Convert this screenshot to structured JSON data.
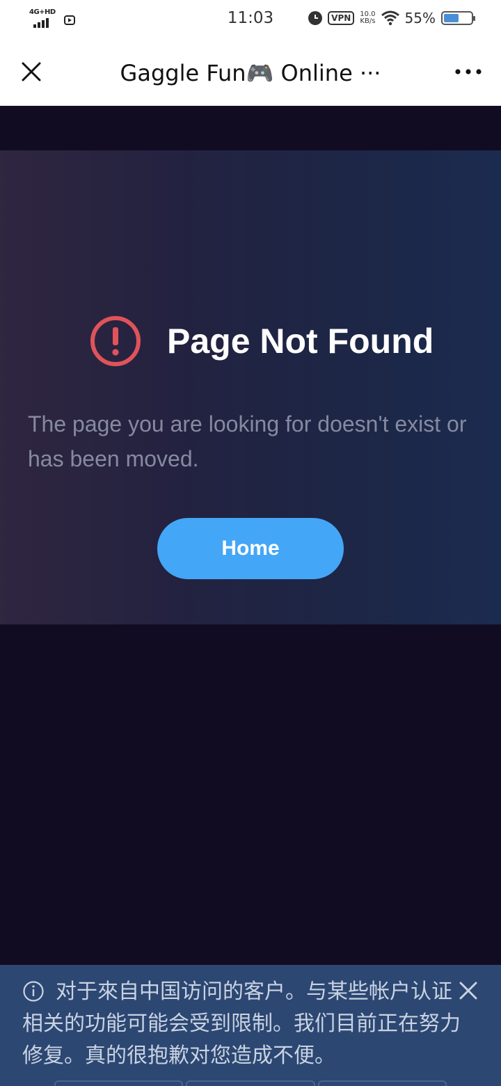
{
  "status_bar": {
    "network": "4G+HD",
    "time": "11:03",
    "vpn": "VPN",
    "speed_value": "10.0",
    "speed_unit": "KB/s",
    "battery": "55%"
  },
  "nav": {
    "title": "Gaggle Fun🎮 Online ···"
  },
  "error": {
    "title": "Page Not Found",
    "message": "The page you are looking for doesn't exist or has been moved.",
    "button_label": "Home"
  },
  "notice": {
    "text": "对于來自中国访问的客户。与某些帐户认证相关的功能可能会受到限制。我们目前正在努力修复。真的很抱歉对您造成不便。"
  },
  "colors": {
    "accent": "#44a6f6",
    "error": "#e0535a",
    "background": "#110c22",
    "notice_bg": "#2c4772"
  }
}
